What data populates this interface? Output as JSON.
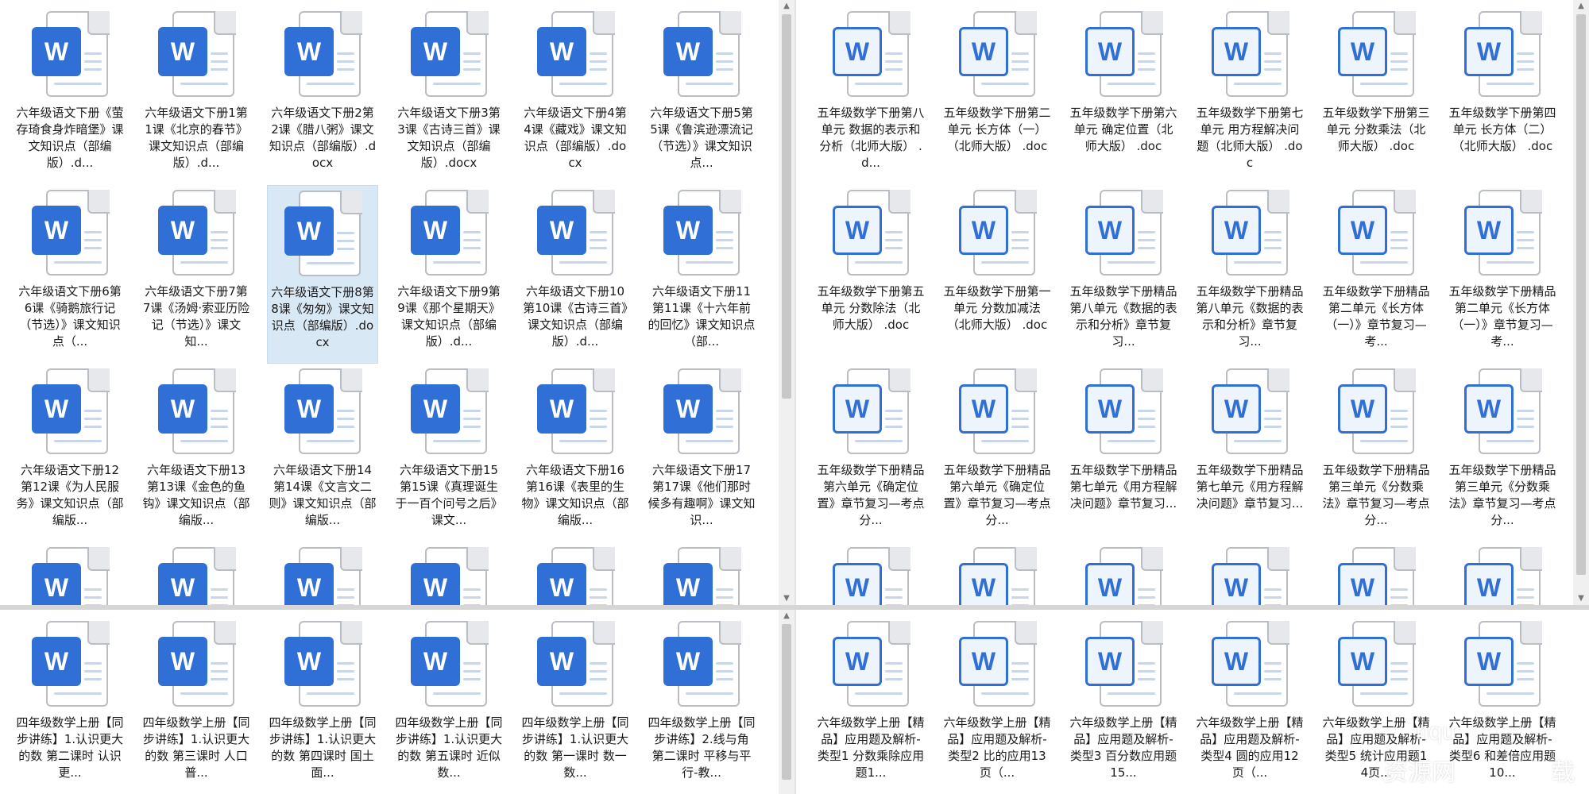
{
  "colors": {
    "word_blue": "#2f6fd6",
    "selected_bg": "#d9e8f5",
    "pane_bg": "#ffffff"
  },
  "icon": {
    "letter": "W"
  },
  "top_left": [
    "六年级语文下册《萤存琦食身炸暗堡》课文知识点（部编版）.d...",
    "六年级语文下册1第1课《北京的春节》课文知识点（部编版）.d...",
    "六年级语文下册2第2课《腊八粥》课文知识点（部编版）.docx",
    "六年级语文下册3第3课《古诗三首》课文知识点（部编版）.docx",
    "六年级语文下册4第4课《藏戏》课文知识点（部编版）.docx",
    "六年级语文下册5第5课《鲁滨逊漂流记（节选）》课文知识点...",
    "六年级语文下册6第6课《骑鹅旅行记（节选）》课文知识点（...",
    "六年级语文下册7第7课《汤姆·索亚历险记（节选）》课文知...",
    "六年级语文下册8第8课《匆匆》课文知识点（部编版）.docx",
    "六年级语文下册9第9课《那个星期天》课文知识点（部编版）.d...",
    "六年级语文下册10第10课《古诗三首》课文知识点（部编版）.d...",
    "六年级语文下册11第11课《十六年前的回忆》课文知识点（部...",
    "六年级语文下册12第12课《为人民服务》课文知识点（部编版...",
    "六年级语文下册13第13课《金色的鱼钩》课文知识点（部编版...",
    "六年级语文下册14第14课《文言文二则》课文知识点（部编版...",
    "六年级语文下册15第15课《真理诞生于一百个问号之后》课文...",
    "六年级语文下册16第16课《表里的生物》课文知识点（部编版...",
    "六年级语文下册17第17课《他们那时候多有趣啊》课文知识...",
    "",
    "",
    "",
    "",
    "",
    ""
  ],
  "top_right": [
    "五年级数学下册第八单元 数据的表示和分析（北师大版） .d...",
    "五年级数学下册第二单元 长方体（一）（北师大版） .doc",
    "五年级数学下册第六单元 确定位置（北师大版） .doc",
    "五年级数学下册第七单元 用方程解决问题（北师大版） .doc",
    "五年级数学下册第三单元 分数乘法（北师大版） .doc",
    "五年级数学下册第四单元 长方体（二）（北师大版） .doc",
    "五年级数学下册第五单元 分数除法（北师大版） .doc",
    "五年级数学下册第一单元 分数加减法（北师大版） .doc",
    "五年级数学下册精品 第八单元《数据的表示和分析》章节复习...",
    "五年级数学下册精品 第八单元《数据的表示和分析》章节复习...",
    "五年级数学下册精品 第二单元《长方体（一）》章节复习—考...",
    "五年级数学下册精品 第二单元《长方体（一）》章节复习—考...",
    "五年级数学下册精品 第六单元《确定位置》章节复习—考点分...",
    "五年级数学下册精品 第六单元《确定位置》章节复习—考点分...",
    "五年级数学下册精品 第七单元《用方程解决问题》章节复习...",
    "五年级数学下册精品 第七单元《用方程解决问题》章节复习...",
    "五年级数学下册精品 第三单元《分数乘法》章节复习—考点分...",
    "五年级数学下册精品 第三单元《分数乘法》章节复习—考点分...",
    "",
    "",
    "",
    "",
    "",
    ""
  ],
  "bottom_left": [
    "四年级数学上册【同步讲练】1.认识更大的数 第二课时 认识更...",
    "四年级数学上册【同步讲练】1.认识更大的数 第三课时 人口普...",
    "四年级数学上册【同步讲练】1.认识更大的数 第四课时 国土面...",
    "四年级数学上册【同步讲练】1.认识更大的数 第五课时 近似数...",
    "四年级数学上册【同步讲练】1.认识更大的数 第一课时 数一数...",
    "四年级数学上册【同步讲练】2.线与角 第二课时 平移与平行-教..."
  ],
  "bottom_right": [
    "六年级数学上册【精品】应用题及解析-类型1 分数乘除应用题1...",
    "六年级数学上册【精品】应用题及解析-类型2 比的应用13页（...",
    "六年级数学上册【精品】应用题及解析-类型3 百分数应用题15...",
    "六年级数学上册【精品】应用题及解析-类型4 圆的应用12页（...",
    "六年级数学上册【精品】应用题及解析-类型5 统计应用题14页...",
    "六年级数学上册【精品】应用题及解析-类型6 和差倍应用题10..."
  ],
  "watermark": {
    "line1": "nqu",
    "line2": "资源网",
    "line3": "载"
  }
}
